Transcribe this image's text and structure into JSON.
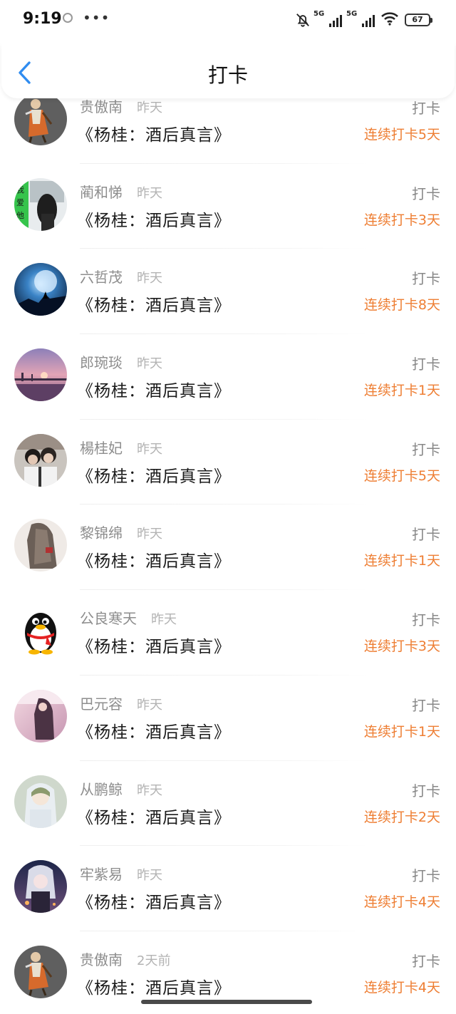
{
  "status_bar": {
    "time": "9:19",
    "network_1": "5G",
    "network_2": "5G",
    "battery": "67"
  },
  "header": {
    "title": "打卡",
    "back_icon": "chevron-left-icon",
    "accent_color": "#2f8cf0"
  },
  "theme": {
    "streak_color": "#ee7e33"
  },
  "entries": [
    {
      "name": "贵傲南",
      "time": "昨天",
      "book": "《杨桂：酒后真言》",
      "action": "打卡",
      "streak": "连续打卡5天",
      "avatar": "avatar-figure"
    },
    {
      "name": "蔺和悌",
      "time": "昨天",
      "book": "《杨桂：酒后真言》",
      "action": "打卡",
      "streak": "连续打卡3天",
      "avatar": "avatar-girl-window"
    },
    {
      "name": "六哲茂",
      "time": "昨天",
      "book": "《杨桂：酒后真言》",
      "action": "打卡",
      "streak": "连续打卡8天",
      "avatar": "avatar-moon-wolf"
    },
    {
      "name": "郎琬琰",
      "time": "昨天",
      "book": "《杨桂：酒后真言》",
      "action": "打卡",
      "streak": "连续打卡1天",
      "avatar": "avatar-sunset-pier"
    },
    {
      "name": "楊桂妃",
      "time": "昨天",
      "book": "《杨桂：酒后真言》",
      "action": "打卡",
      "streak": "连续打卡5天",
      "avatar": "avatar-two-people"
    },
    {
      "name": "黎锦绵",
      "time": "昨天",
      "book": "《杨桂：酒后真言》",
      "action": "打卡",
      "streak": "连续打卡1天",
      "avatar": "avatar-long-hair"
    },
    {
      "name": "公良寒天",
      "time": "昨天",
      "book": "《杨桂：酒后真言》",
      "action": "打卡",
      "streak": "连续打卡3天",
      "avatar": "avatar-penguin"
    },
    {
      "name": "巴元容",
      "time": "昨天",
      "book": "《杨桂：酒后真言》",
      "action": "打卡",
      "streak": "连续打卡1天",
      "avatar": "avatar-pink-girl"
    },
    {
      "name": "从鹏鲸",
      "time": "昨天",
      "book": "《杨桂：酒后真言》",
      "action": "打卡",
      "streak": "连续打卡2天",
      "avatar": "avatar-anime-hood"
    },
    {
      "name": "牢紫易",
      "time": "昨天",
      "book": "《杨桂：酒后真言》",
      "action": "打卡",
      "streak": "连续打卡4天",
      "avatar": "avatar-anime-dark"
    },
    {
      "name": "贵傲南",
      "time": "2天前",
      "book": "《杨桂：酒后真言》",
      "action": "打卡",
      "streak": "连续打卡4天",
      "avatar": "avatar-figure"
    }
  ]
}
